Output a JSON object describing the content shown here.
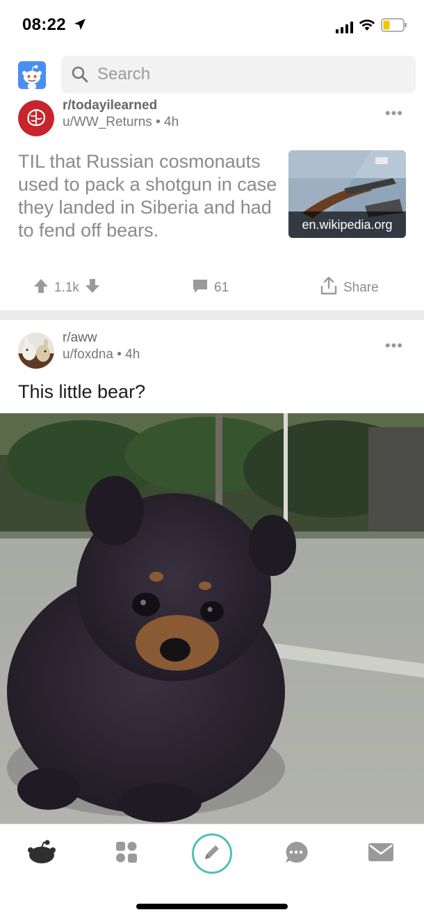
{
  "status_bar": {
    "time": "08:22"
  },
  "search": {
    "placeholder": "Search"
  },
  "posts": [
    {
      "subreddit": "r/todayilearned",
      "user": "u/WW_Returns",
      "age": "4h",
      "title": "TIL that Russian cosmonauts used to pack a shotgun in case they landed in Siberia and had to fend off bears.",
      "link_domain": "en.wikipedia.org",
      "upvotes": "1.1k",
      "comments": "61",
      "share_label": "Share"
    },
    {
      "subreddit": "r/aww",
      "user": "u/foxdna",
      "age": "4h",
      "title": "This little bear?"
    }
  ],
  "colors": {
    "accent": "#4dc2b3",
    "snoo_bg": "#4a8ef0",
    "tab_icon": "#9a9a9a"
  },
  "tabs": [
    "home-icon",
    "communities-icon",
    "compose-icon",
    "chat-icon",
    "inbox-icon"
  ]
}
